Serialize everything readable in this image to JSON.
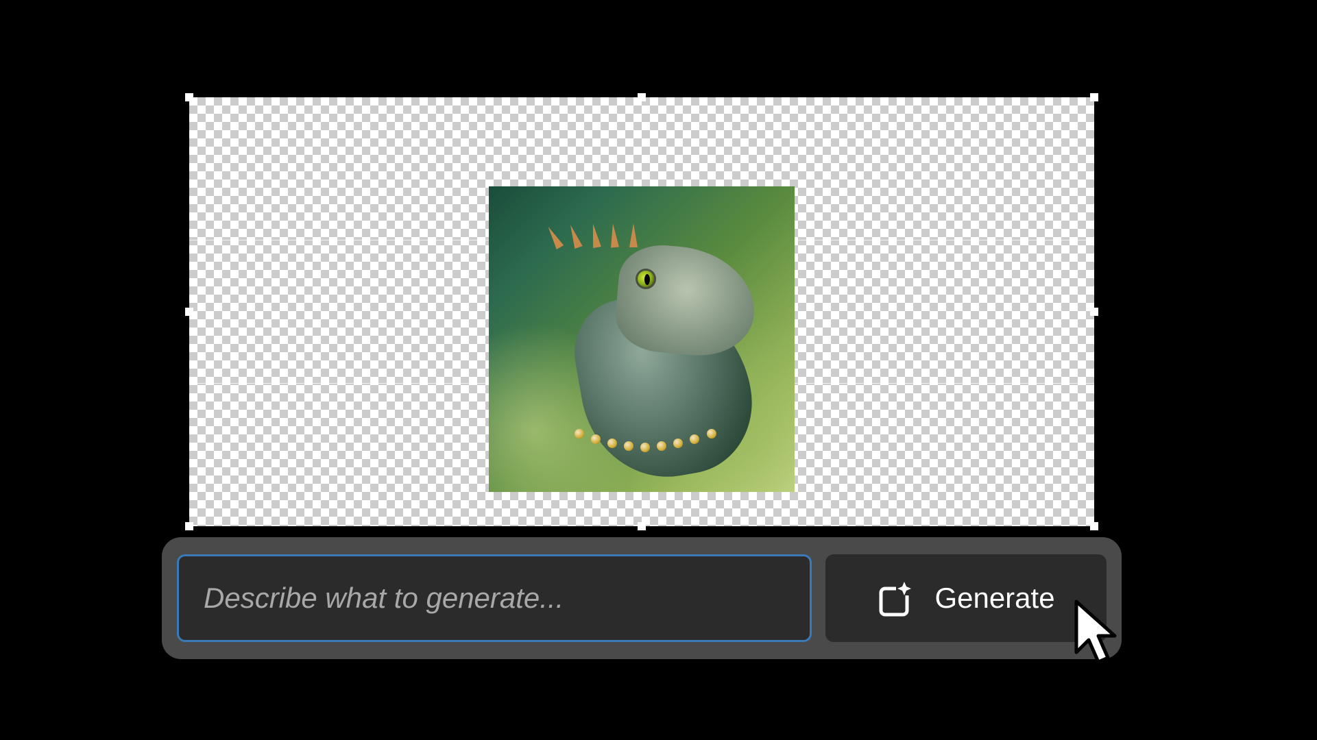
{
  "prompt": {
    "placeholder": "Describe what to generate...",
    "value": ""
  },
  "generate_button": {
    "label": "Generate"
  },
  "canvas": {
    "image_description": "iguana-portrait"
  }
}
